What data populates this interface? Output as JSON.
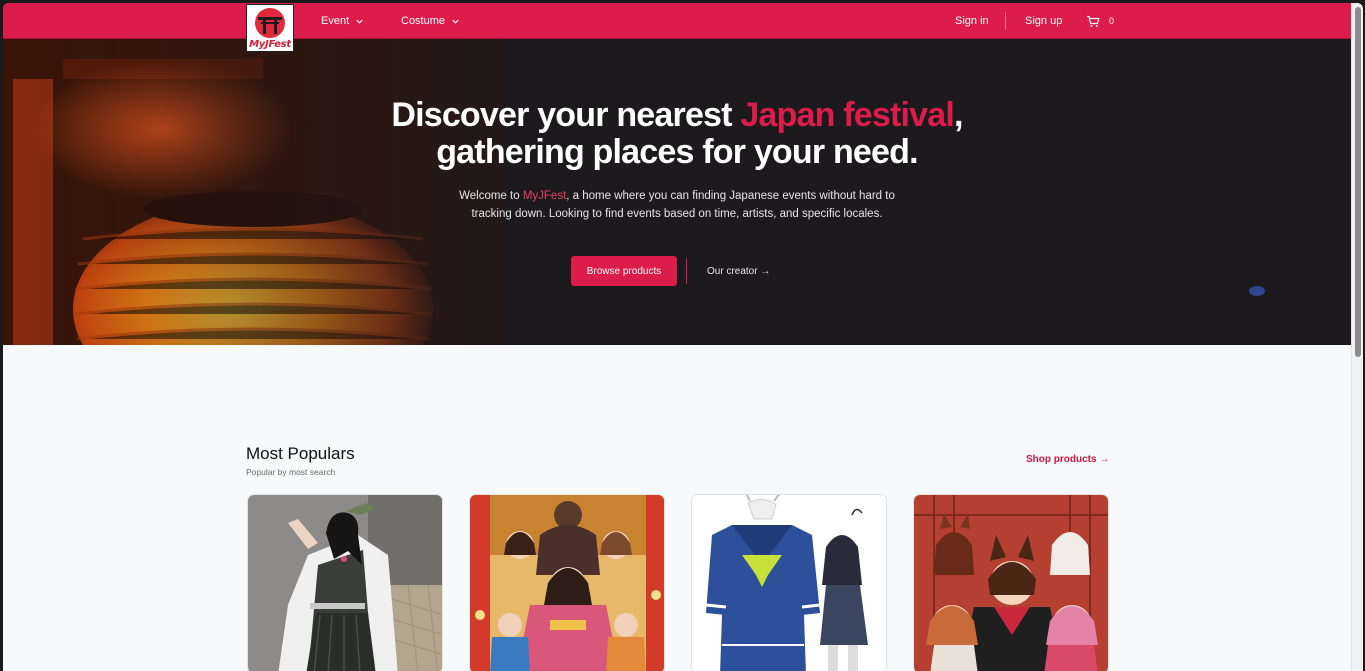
{
  "navbar": {
    "logo_text": "MyJFest",
    "menu": [
      {
        "label": "Event"
      },
      {
        "label": "Costume"
      }
    ],
    "sign_in": "Sign in",
    "sign_up": "Sign up",
    "cart_count": "0",
    "accent_color": "#dc1c4b"
  },
  "hero": {
    "title_part1": "Discover your nearest ",
    "title_highlight": "Japan festival",
    "title_part2": ",",
    "title_line2": "gathering places for your need.",
    "desc_prefix": "Welcome to ",
    "desc_brand": "MyJFest",
    "desc_rest": ", a home where you can finding Japanese events without hard to tracking down. Looking to find events based on time, artists, and specific locales.",
    "primary_button": "Browse products",
    "secondary_link": "Our creator →"
  },
  "popular": {
    "title": "Most Populars",
    "subtitle": "Popular by most search",
    "shop_link": "Shop products →",
    "cards": [
      {
        "icon": "cosplay-photo"
      },
      {
        "icon": "anime-festival-poster"
      },
      {
        "icon": "sailor-uniform-costume"
      },
      {
        "icon": "kitsune-anime-illustration"
      }
    ]
  }
}
